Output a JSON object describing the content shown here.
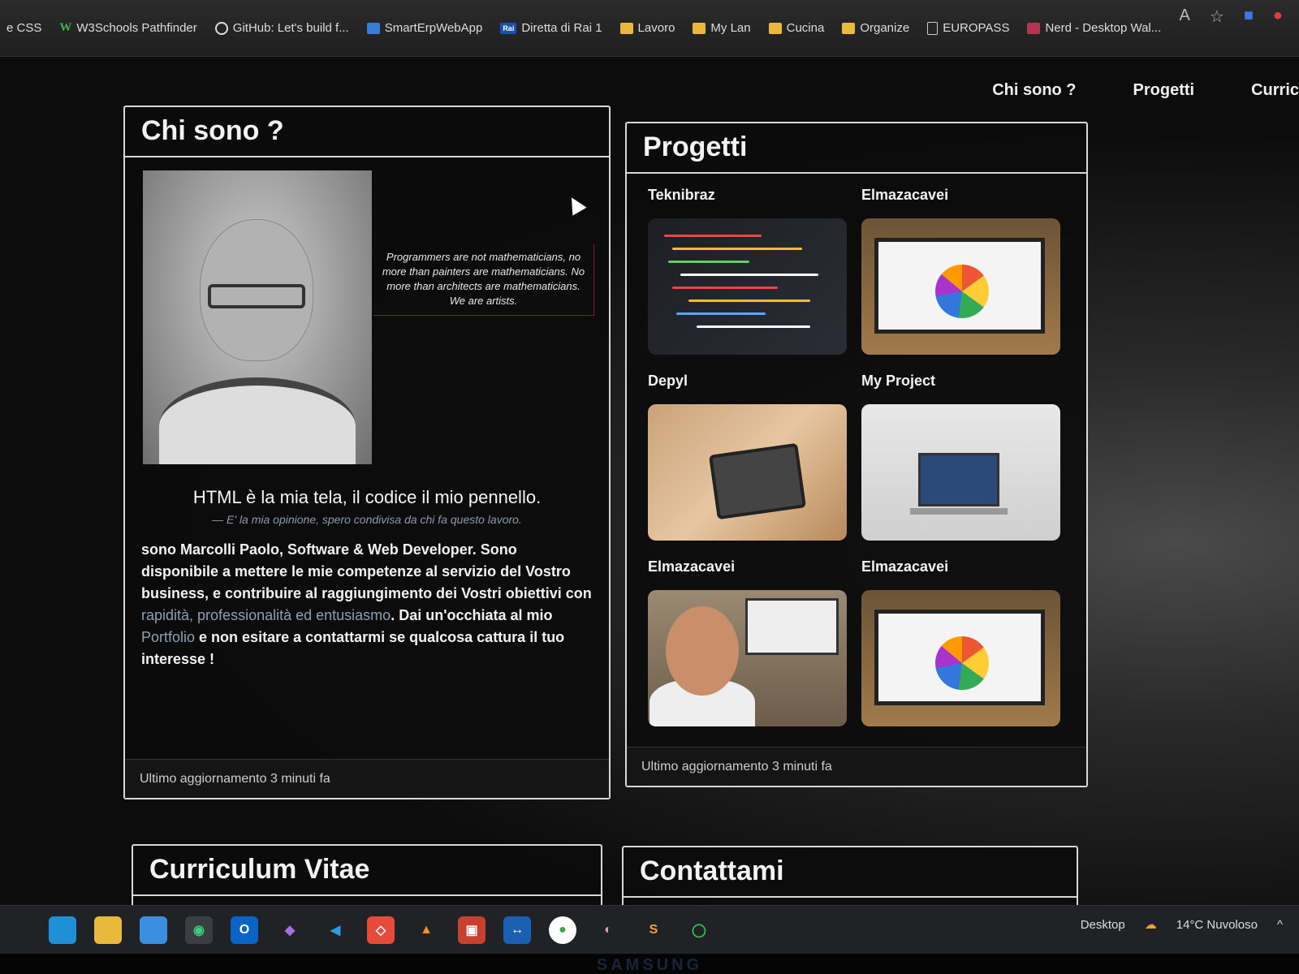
{
  "bookmarks": [
    {
      "label": "e CSS",
      "icon": "none"
    },
    {
      "label": "W3Schools Pathfinder",
      "icon": "w3schools-icon"
    },
    {
      "label": "GitHub: Let's build f...",
      "icon": "github-icon"
    },
    {
      "label": "SmartErpWebApp",
      "icon": "sheet-icon"
    },
    {
      "label": "Diretta di Rai 1",
      "icon": "rai-icon"
    },
    {
      "label": "Lavoro",
      "icon": "folder-icon"
    },
    {
      "label": "My Lan",
      "icon": "folder-icon"
    },
    {
      "label": "Cucina",
      "icon": "folder-icon"
    },
    {
      "label": "Organize",
      "icon": "folder-icon"
    },
    {
      "label": "EUROPASS",
      "icon": "doc-icon"
    },
    {
      "label": "Nerd - Desktop Wal...",
      "icon": "nerd-icon"
    }
  ],
  "nav": {
    "chi_sono": "Chi sono ?",
    "progetti": "Progetti",
    "curriculum": "Curric"
  },
  "chi_sono": {
    "title": "Chi sono ?",
    "quote": "Programmers are not mathematicians, no more than painters are mathematicians. No more than architects are mathematicians. We are artists.",
    "tagline": "HTML è la mia tela, il codice il mio pennello.",
    "tagline_sub": "— E' la mia opinione, spero condivisa da chi fa questo lavoro.",
    "bio_1": "sono Marcolli Paolo, Software & Web Developer. Sono disponibile a mettere le mie competenze al servizio del Vostro business, e contribuire al raggiungimento dei Vostri obiettivi con ",
    "bio_highlight_1": "rapidità, professionalità ed entusiasmo",
    "bio_2": ". Dai un'occhiata al mio ",
    "bio_link": "Portfolio",
    "bio_3": " e non esitare a contattarmi se qualcosa cattura il tuo interesse !",
    "footer": "Ultimo aggiornamento 3 minuti fa"
  },
  "progetti": {
    "title": "Progetti",
    "items": [
      {
        "name": "Teknibraz"
      },
      {
        "name": "Elmazacavei"
      },
      {
        "name": "Depyl"
      },
      {
        "name": "My Project"
      },
      {
        "name": "Elmazacavei"
      },
      {
        "name": "Elmazacavei"
      }
    ],
    "footer": "Ultimo aggiornamento 3 minuti fa"
  },
  "curriculum": {
    "title": "Curriculum Vitae"
  },
  "contattami": {
    "title": "Contattami"
  },
  "tray": {
    "desktop": "Desktop",
    "weather": "14°C  Nuvoloso"
  },
  "brand": "SAMSUNG"
}
